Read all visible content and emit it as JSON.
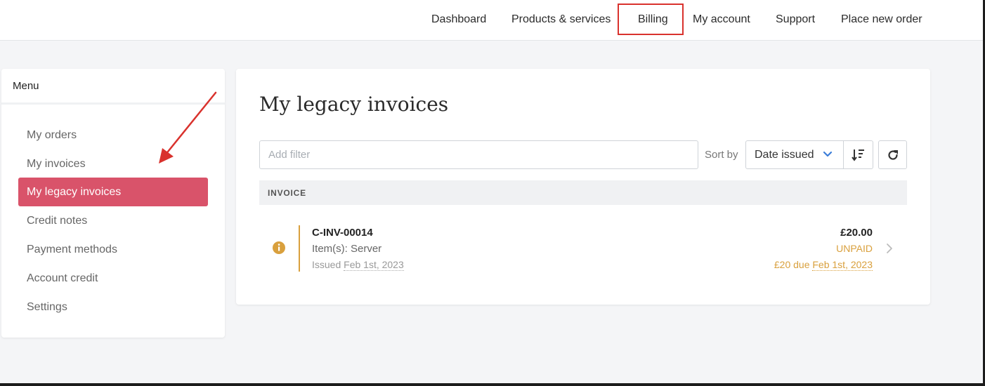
{
  "nav": {
    "items": [
      {
        "label": "Dashboard"
      },
      {
        "label": "Products & services"
      },
      {
        "label": "Billing"
      },
      {
        "label": "My account"
      },
      {
        "label": "Support"
      },
      {
        "label": "Place new order"
      }
    ],
    "active": "Billing"
  },
  "sidebar": {
    "title": "Menu",
    "items": [
      {
        "label": "My orders"
      },
      {
        "label": "My invoices"
      },
      {
        "label": "My legacy invoices",
        "active": true
      },
      {
        "label": "Credit notes"
      },
      {
        "label": "Payment methods"
      },
      {
        "label": "Account credit"
      },
      {
        "label": "Settings"
      }
    ]
  },
  "main": {
    "title": "My legacy invoices",
    "filter": {
      "placeholder": "Add filter",
      "value": ""
    },
    "sort": {
      "label": "Sort by",
      "value": "Date issued"
    },
    "table": {
      "header": "INVOICE",
      "rows": [
        {
          "number": "C-INV-00014",
          "items": "Item(s): Server",
          "issued_label": "Issued",
          "issued_date": "Feb 1st, 2023",
          "amount": "£20.00",
          "status": "UNPAID",
          "due_prefix": "£20 due",
          "due_date": "Feb 1st, 2023"
        }
      ]
    }
  },
  "colors": {
    "active_menu": "#d9536a",
    "annotation": "#d9322d",
    "unpaid": "#d9a03d",
    "chevron_blue": "#3b7dd8"
  },
  "icons": [
    "info-icon",
    "chevron-down-icon",
    "sort-descending-icon",
    "refresh-icon",
    "chevron-right-icon",
    "annotation-arrow"
  ]
}
